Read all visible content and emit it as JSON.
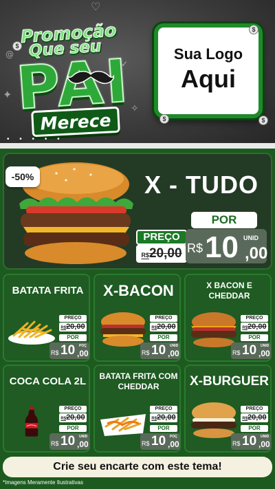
{
  "header": {
    "promo_line1": "Promoção",
    "promo_line2": "Que seu",
    "pai_word": "PAI",
    "merece": "Merece",
    "logo_line1": "Sua Logo",
    "logo_line2": "Aqui",
    "coin_symbol": "$"
  },
  "featured": {
    "title": "X - TUDO",
    "discount": "-50%",
    "por_label": "POR",
    "preco_label": "PREÇO",
    "old_price_currency": "R$",
    "old_price_value": "20,00",
    "currency": "R$",
    "price_int": "10",
    "price_cents": ",00",
    "unit": "UNID"
  },
  "cards": [
    {
      "title": "BATATA FRITA",
      "preco_label": "PREÇO",
      "old_currency": "R$",
      "old_value": "20,00",
      "por_label": "POR",
      "currency": "R$",
      "price_int": "10",
      "price_cents": ",00",
      "unit": "POÇ",
      "image": "fries-icon"
    },
    {
      "title": "X-BACON",
      "preco_label": "PREÇO",
      "old_currency": "R$",
      "old_value": "20,00",
      "por_label": "POR",
      "currency": "R$",
      "price_int": "10",
      "price_cents": ",00",
      "unit": "UNID",
      "image": "burger-icon"
    },
    {
      "title": "X BACON E CHEDDAR",
      "preco_label": "PREÇO",
      "old_currency": "R$",
      "old_value": "20,00",
      "por_label": "POR",
      "currency": "R$",
      "price_int": "10",
      "price_cents": ",00",
      "unit": "UNID",
      "image": "cheddar-burger-icon"
    },
    {
      "title": "COCA COLA 2L",
      "preco_label": "PREÇO",
      "old_currency": "R$",
      "old_value": "20,00",
      "por_label": "POR",
      "currency": "R$",
      "price_int": "10",
      "price_cents": ",00",
      "unit": "UNID",
      "image": "soda-bottle-icon"
    },
    {
      "title": "BATATA FRITA COM CHEDDAR",
      "preco_label": "PREÇO",
      "old_currency": "R$",
      "old_value": "20,00",
      "por_label": "POR",
      "currency": "R$",
      "price_int": "10",
      "price_cents": ",00",
      "unit": "POÇ",
      "image": "cheddar-fries-icon"
    },
    {
      "title": "X-BURGUER",
      "preco_label": "PREÇO",
      "old_currency": "R$",
      "old_value": "20,00",
      "por_label": "POR",
      "currency": "R$",
      "price_int": "10",
      "price_cents": ",00",
      "unit": "UNID",
      "image": "burger-icon"
    }
  ],
  "footer": {
    "cta": "Crie seu encarte com este tema!",
    "disclaimer": "*Imagens Meramente Ilustrativas"
  },
  "colors": {
    "brand_green": "#1f8a2a",
    "card_green": "#1f5b22",
    "header_dark": "#3b3b3b",
    "price_gray": "#5a6a5a"
  }
}
